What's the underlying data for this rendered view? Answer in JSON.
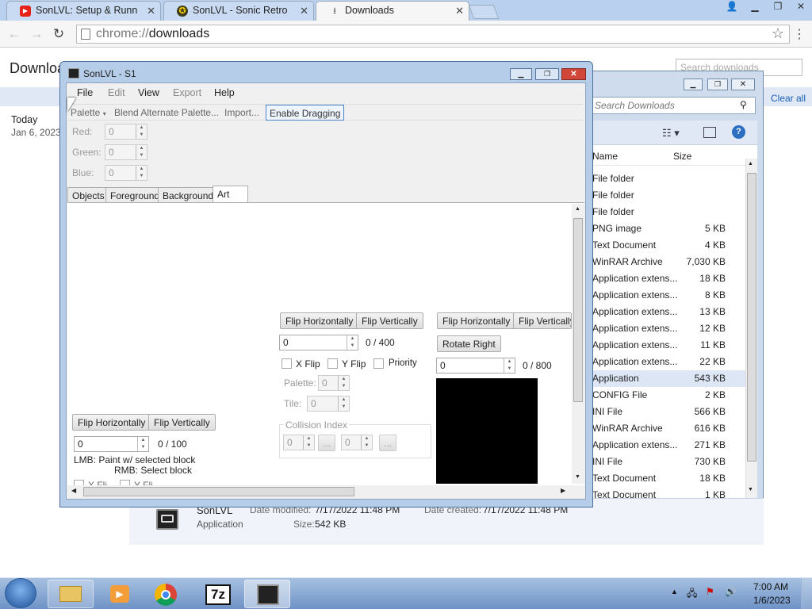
{
  "browser": {
    "tabs": [
      {
        "label": "SonLVL: Setup & Runn",
        "icon": "youtube-icon"
      },
      {
        "label": "SonLVL - Sonic Retro",
        "icon": "sonic-retro-icon"
      },
      {
        "label": "Downloads",
        "icon": "download-icon"
      }
    ],
    "close_glyph": "✕",
    "url_scheme": "chrome://",
    "url_host": "downloads"
  },
  "downloads_page": {
    "title": "Downloads",
    "search_placeholder": "Search downloads",
    "clear_all": "Clear all",
    "date_group": "Today",
    "date": "Jan 6, 2023"
  },
  "explorer": {
    "search_placeholder": "Search Downloads",
    "columns": {
      "name": "Name",
      "size": "Size"
    },
    "rows": [
      {
        "type": "File folder",
        "size": ""
      },
      {
        "type": "File folder",
        "size": ""
      },
      {
        "type": "File folder",
        "size": ""
      },
      {
        "type": "PNG image",
        "size": "5 KB"
      },
      {
        "type": "Text Document",
        "size": "4 KB"
      },
      {
        "type": "WinRAR Archive",
        "size": "7,030 KB"
      },
      {
        "type": "Application extens...",
        "size": "18 KB"
      },
      {
        "type": "Application extens...",
        "size": "8 KB"
      },
      {
        "type": "Application extens...",
        "size": "13 KB"
      },
      {
        "type": "Application extens...",
        "size": "12 KB"
      },
      {
        "type": "Application extens...",
        "size": "11 KB"
      },
      {
        "type": "Application extens...",
        "size": "22 KB"
      },
      {
        "type": "Application",
        "size": "543 KB"
      },
      {
        "type": "CONFIG File",
        "size": "2 KB"
      },
      {
        "type": "INI File",
        "size": "566 KB"
      },
      {
        "type": "WinRAR Archive",
        "size": "616 KB"
      },
      {
        "type": "Application extens...",
        "size": "271 KB"
      },
      {
        "type": "INI File",
        "size": "730 KB"
      },
      {
        "type": "Text Document",
        "size": "18 KB"
      },
      {
        "type": "Text Document",
        "size": "1 KB"
      }
    ],
    "details": {
      "name": "SonLVL",
      "type": "Application",
      "modified_label": "Date modified:",
      "modified": "7/17/2022 11:48 PM",
      "created_label": "Date created:",
      "created": "7/17/2022 11:48 PM",
      "size_label": "Size:",
      "size": "542 KB"
    }
  },
  "sonlvl": {
    "title": "SonLVL - S1",
    "menu": [
      "File",
      "Edit",
      "View",
      "Export",
      "Help"
    ],
    "toolbar": {
      "palette": "Palette",
      "blend": "Blend Alternate Palette...",
      "import": "Import...",
      "dragging": "Enable Dragging"
    },
    "color": {
      "red_label": "Red:",
      "green_label": "Green:",
      "blue_label": "Blue:",
      "red": "0",
      "green": "0",
      "blue": "0"
    },
    "tabs": [
      "Objects",
      "Foreground",
      "Background",
      "Art"
    ],
    "left": {
      "flip_h": "Flip Horizontally",
      "flip_v": "Flip Vertically",
      "index": "0",
      "count": "0 / 100",
      "lmb": "LMB: Paint w/ selected block",
      "rmb": "RMB: Select block",
      "xflip_cut": "X Fli",
      "yflip_cut": "Y Fli"
    },
    "middle": {
      "flip_h": "Flip Horizontally",
      "flip_v": "Flip Vertically",
      "index": "0",
      "count": "0 / 400",
      "xflip": "X Flip",
      "yflip": "Y Flip",
      "priority": "Priority",
      "palette_label": "Palette:",
      "palette": "0",
      "tile_label": "Tile:",
      "tile": "0",
      "collision_legend": "Collision Index",
      "coll1": "0",
      "coll2": "0",
      "ellipsis": "..."
    },
    "right": {
      "flip_h": "Flip Horizontally",
      "flip_v": "Flip Vertically",
      "rotate": "Rotate Right",
      "index": "0",
      "count": "0 / 800"
    }
  },
  "taskbar": {
    "apps": [
      "start-orb",
      "explorer",
      "media-player",
      "chrome",
      "7zip",
      "sonlvl"
    ],
    "sevenzip_label": "7z",
    "time": "7:00 AM",
    "date": "1/6/2023"
  },
  "colors": {
    "accent": "#1a5fb4",
    "taskbar": "#8eaed8",
    "title_blue": "#b6cde9"
  }
}
